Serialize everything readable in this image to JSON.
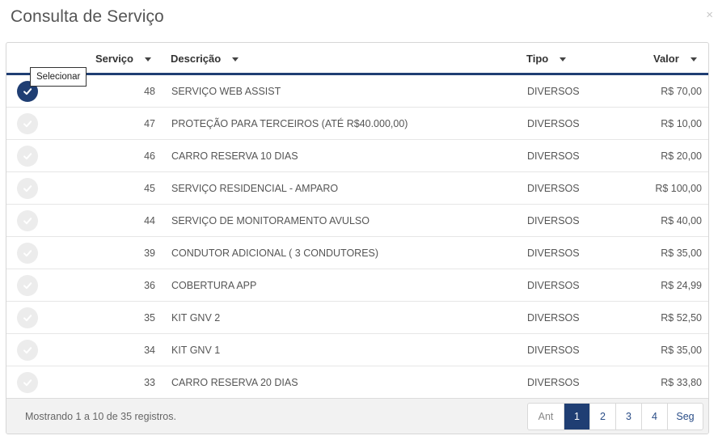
{
  "modal": {
    "title": "Consulta de Serviço",
    "close": "×"
  },
  "table": {
    "headers": {
      "servico": "Serviço",
      "descricao": "Descrição",
      "tipo": "Tipo",
      "valor": "Valor"
    },
    "rows": [
      {
        "servico": "48",
        "descricao": "SERVIÇO WEB ASSIST",
        "tipo": "DIVERSOS",
        "valor": "R$ 70,00",
        "selected": true
      },
      {
        "servico": "47",
        "descricao": "PROTEÇÃO PARA TERCEIROS (ATÉ R$40.000,00)",
        "tipo": "DIVERSOS",
        "valor": "R$ 10,00",
        "selected": false
      },
      {
        "servico": "46",
        "descricao": "CARRO RESERVA 10 DIAS",
        "tipo": "DIVERSOS",
        "valor": "R$ 20,00",
        "selected": false
      },
      {
        "servico": "45",
        "descricao": "SERVIÇO RESIDENCIAL - AMPARO",
        "tipo": "DIVERSOS",
        "valor": "R$ 100,00",
        "selected": false
      },
      {
        "servico": "44",
        "descricao": "SERVIÇO DE MONITORAMENTO AVULSO",
        "tipo": "DIVERSOS",
        "valor": "R$ 40,00",
        "selected": false
      },
      {
        "servico": "39",
        "descricao": "CONDUTOR ADICIONAL ( 3 CONDUTORES)",
        "tipo": "DIVERSOS",
        "valor": "R$ 35,00",
        "selected": false
      },
      {
        "servico": "36",
        "descricao": "COBERTURA APP",
        "tipo": "DIVERSOS",
        "valor": "R$ 24,99",
        "selected": false
      },
      {
        "servico": "35",
        "descricao": "KIT GNV 2",
        "tipo": "DIVERSOS",
        "valor": "R$ 52,50",
        "selected": false
      },
      {
        "servico": "34",
        "descricao": "KIT GNV 1",
        "tipo": "DIVERSOS",
        "valor": "R$ 35,00",
        "selected": false
      },
      {
        "servico": "33",
        "descricao": "CARRO RESERVA 20 DIAS",
        "tipo": "DIVERSOS",
        "valor": "R$ 33,80",
        "selected": false
      }
    ]
  },
  "tooltip": "Selecionar",
  "footer": {
    "info": "Mostrando 1 a 10 de 35 registros."
  },
  "pagination": {
    "prev": "Ant",
    "pages": [
      "1",
      "2",
      "3",
      "4"
    ],
    "active_page": "1",
    "next": "Seg"
  },
  "colors": {
    "accent": "#1f3e73",
    "check_off": "#ececec"
  }
}
